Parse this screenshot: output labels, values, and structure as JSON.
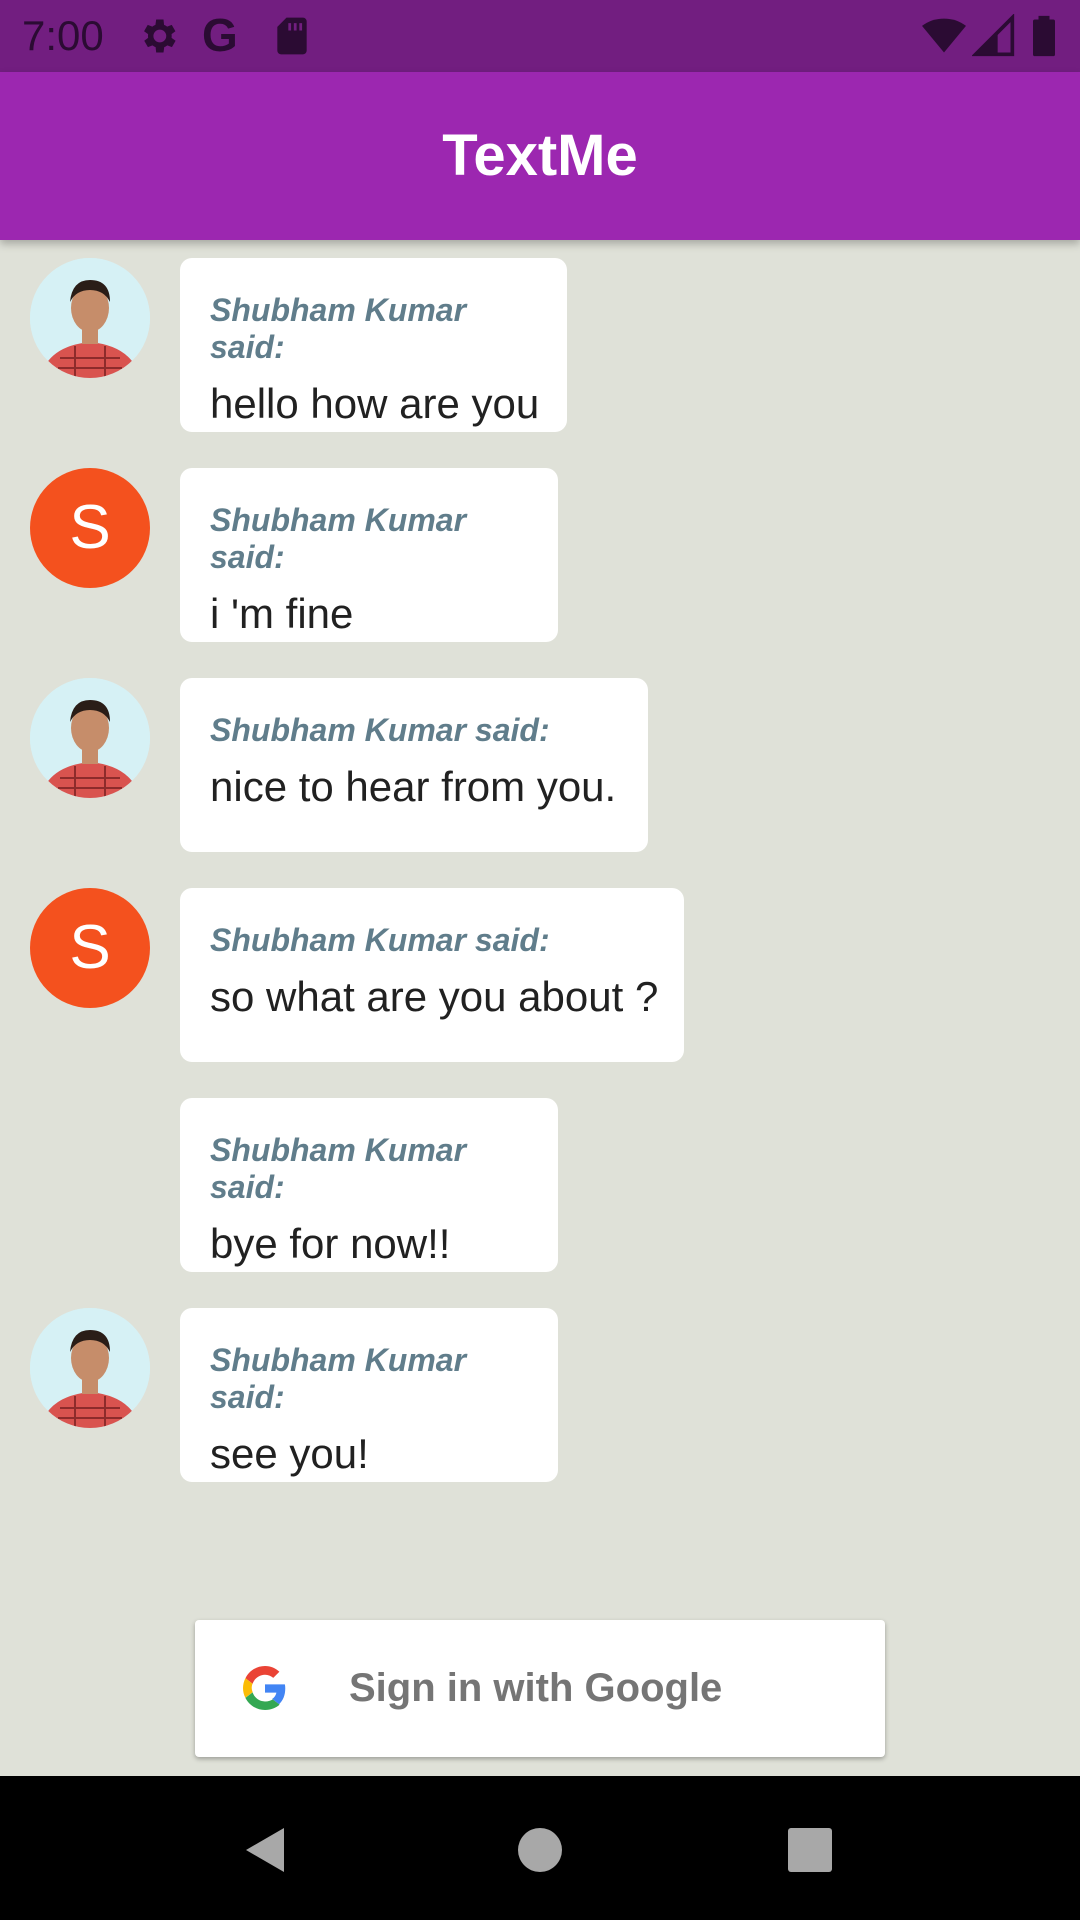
{
  "status_bar": {
    "time": "7:00",
    "icons": [
      "gear-icon",
      "google-g-icon",
      "sd-card-icon",
      "wifi-icon",
      "signal-icon",
      "battery-icon"
    ]
  },
  "app_bar": {
    "title": "TextMe"
  },
  "messages": [
    {
      "avatar": "photo",
      "sender": "Shubham Kumar said:",
      "text": "hello how are you"
    },
    {
      "avatar": "letter",
      "avatar_letter": "S",
      "sender": "Shubham Kumar said:",
      "text": "i 'm fine"
    },
    {
      "avatar": "photo",
      "sender": "Shubham Kumar said:",
      "text": "nice to hear from you."
    },
    {
      "avatar": "letter",
      "avatar_letter": "S",
      "sender": "Shubham Kumar said:",
      "text": "so what are you about ?"
    },
    {
      "avatar": "none",
      "sender": "Shubham Kumar said:",
      "text": "bye for now!!"
    },
    {
      "avatar": "photo",
      "sender": "Shubham Kumar said:",
      "text": "see you!"
    }
  ],
  "sign_in": {
    "label": "Sign in with Google",
    "icon": "google-logo-icon"
  },
  "nav_bar": {
    "icons": [
      "back-icon",
      "home-icon",
      "recents-icon"
    ]
  },
  "colors": {
    "app_bar": "#9c27b0",
    "status_bar": "#721e80",
    "background": "#dfe1d8",
    "letter_avatar": "#f4511e",
    "sender_name": "#607d8b"
  }
}
